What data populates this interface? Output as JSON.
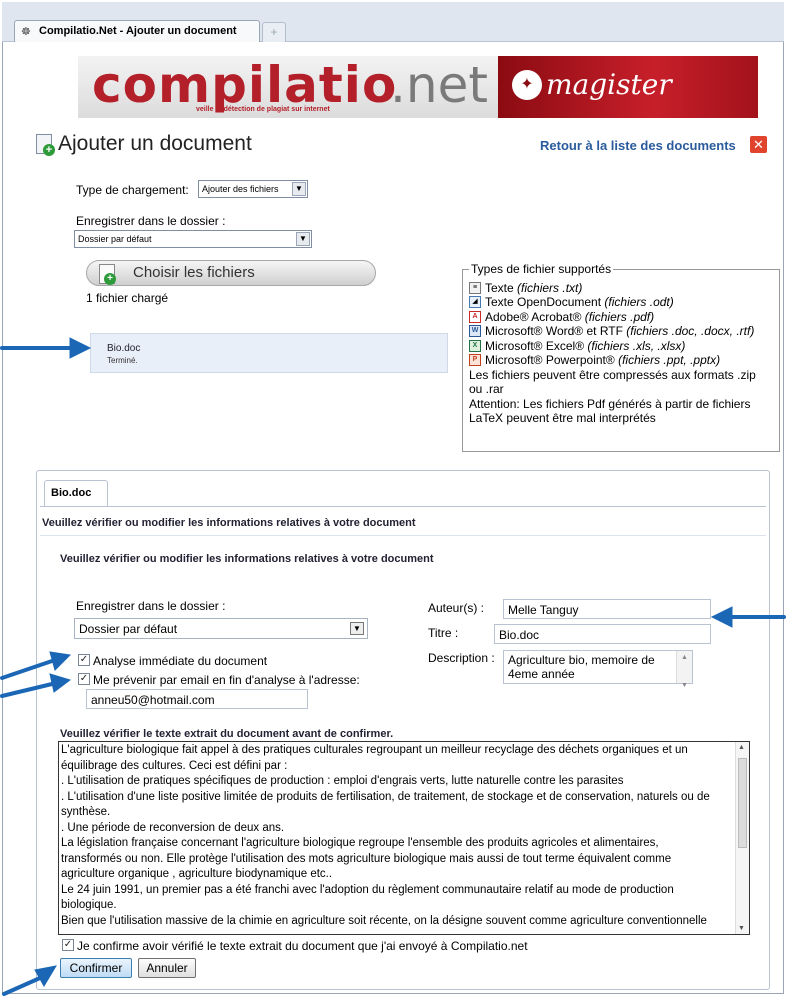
{
  "browser": {
    "tab_title": "Compilatio.Net - Ajouter un document",
    "new_tab": "+"
  },
  "banner": {
    "logo_main": "compilatio",
    "logo_suffix": ".net",
    "tagline": "veille et détection de plagiat sur internet",
    "product": "magister"
  },
  "header": {
    "title": "Ajouter un document",
    "back_link": "Retour à la liste des documents",
    "close": "✕"
  },
  "upload": {
    "type_label": "Type de chargement:",
    "type_value": "Ajouter des fichiers",
    "folder_label": "Enregistrer dans le dossier :",
    "folder_value": "Dossier par défaut",
    "choose_button": "Choisir les fichiers",
    "loaded_count": "1 fichier chargé",
    "file_name": "Bio.doc",
    "file_status": "Terminé."
  },
  "supported_types": {
    "legend": "Types de fichier supportés",
    "items": [
      {
        "name": "Texte",
        "ext": "(fichiers .txt)",
        "icon": "text-file-icon"
      },
      {
        "name": "Texte OpenDocument",
        "ext": "(fichiers .odt)",
        "icon": "opendocument-icon"
      },
      {
        "name": "Adobe® Acrobat®",
        "ext": "(fichiers .pdf)",
        "icon": "pdf-icon"
      },
      {
        "name": "Microsoft® Word® et RTF",
        "ext": "(fichiers .doc, .docx, .rtf)",
        "icon": "word-icon"
      },
      {
        "name": "Microsoft® Excel®",
        "ext": "(fichiers .xls, .xlsx)",
        "icon": "excel-icon"
      },
      {
        "name": "Microsoft® Powerpoint®",
        "ext": "(fichiers .ppt, .pptx)",
        "icon": "powerpoint-icon"
      }
    ],
    "note_zip_1": "Les fichiers peuvent être compressés aux formats .zip",
    "note_zip_2": "ou .rar",
    "note_pdf_1": "Attention: Les fichiers Pdf générés à partir de fichiers",
    "note_pdf_2": "LaTeX peuvent être mal interprétés"
  },
  "document": {
    "tab": "Bio.doc",
    "heading": "Veuillez vérifier ou modifier les informations relatives à votre document",
    "subheading": "Veuillez vérifier ou modifier les informations relatives à votre document",
    "folder_label": "Enregistrer dans le dossier :",
    "folder_value": "Dossier par défaut",
    "analyse_label": "Analyse immédiate du document",
    "notify_label": "Me prévenir par email en fin d'analyse à l'adresse:",
    "email": "anneu50@hotmail.com",
    "author_label": "Auteur(s) :",
    "author_value": "Melle Tanguy",
    "title_label": "Titre :",
    "title_value": "Bio.doc",
    "description_label": "Description :",
    "description_line1": "Agriculture bio, memoire de",
    "description_line2": "4eme année"
  },
  "extract": {
    "title": "Veuillez vérifier le texte extrait du document avant de confirmer.",
    "lines": [
      "L'agriculture biologique fait appel à des pratiques culturales regroupant un meilleur recyclage des déchets organiques et un",
      "équilibrage des cultures. Ceci est défini par :",
      ". L'utilisation de pratiques spécifiques de production : emploi d'engrais verts, lutte naturelle contre les parasites",
      ". L'utilisation d'une liste positive limitée de produits de fertilisation, de traitement, de stockage et de conservation, naturels ou de",
      "synthèse.",
      ". Une période de reconversion de deux ans.",
      "La législation française concernant l'agriculture biologique regroupe l'ensemble des produits agricoles et alimentaires,",
      "transformés ou non. Elle protège l'utilisation des mots agriculture biologique mais aussi de tout terme équivalent comme",
      "agriculture organique , agriculture biodynamique etc..",
      "Le 24 juin 1991, un premier pas a été franchi avec l'adoption du règlement communautaire relatif au mode de production",
      "biologique.",
      "Bien que l'utilisation massive de la chimie en agriculture soit récente, on la désigne souvent comme agriculture conventionnelle"
    ],
    "confirm_check_label": "Je confirme avoir vérifié le texte extrait du document que j'ai envoyé à Compilatio.net",
    "confirm_button": "Confirmer",
    "cancel_button": "Annuler"
  },
  "colors": {
    "brand_red": "#b3202a",
    "link_blue": "#2a5b9c",
    "arrow_blue": "#1b67b6"
  }
}
